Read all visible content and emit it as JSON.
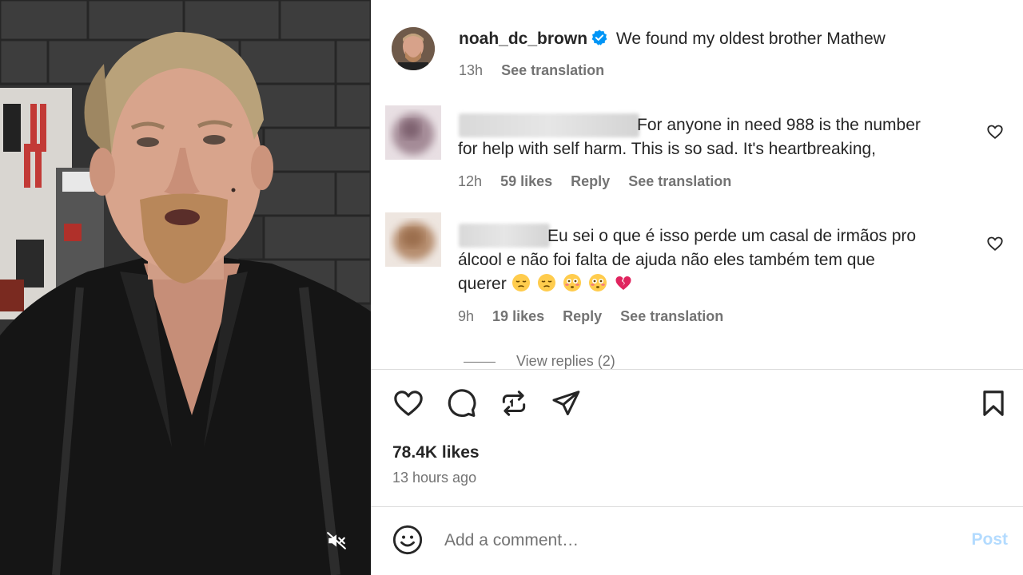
{
  "post": {
    "username": "noah_dc_brown",
    "caption": "We found my oldest brother Mathew",
    "time": "13h",
    "see_translation": "See translation",
    "likes": "78.4K likes",
    "time_ago": "13 hours ago"
  },
  "comments": [
    {
      "lines": [
        "For anyone in need 988 is the number",
        "for help with self harm. This is so sad. It's heartbreaking,"
      ],
      "time": "12h",
      "likes": "59 likes",
      "reply": "Reply",
      "see_translation": "See translation"
    },
    {
      "lines": [
        "Eu sei o que é isso perde um casal de irmãos pro",
        "álcool e não foi falta de ajuda não eles também tem que",
        "querer"
      ],
      "emojis": [
        "pensive-face",
        "pensive-face",
        "flushed-face",
        "flushed-face",
        "broken-heart"
      ],
      "time": "9h",
      "likes": "19 likes",
      "reply": "Reply",
      "see_translation": "See translation"
    }
  ],
  "view_replies": "View replies (2)",
  "add_comment": {
    "placeholder": "Add a comment…",
    "post_label": "Post"
  },
  "icons": {
    "like": "heart-icon",
    "comment": "comment-bubble-icon",
    "share": "repost-icon",
    "send": "paper-plane-icon",
    "save": "bookmark-icon",
    "mute": "speaker-muted-icon",
    "emoji": "smiley-icon",
    "verified": "verified-badge-icon"
  },
  "colors": {
    "verified_blue": "#0095f6",
    "post_disabled": "#b3dbff",
    "muted_text": "#737373",
    "broken_heart": "#e0245e"
  }
}
